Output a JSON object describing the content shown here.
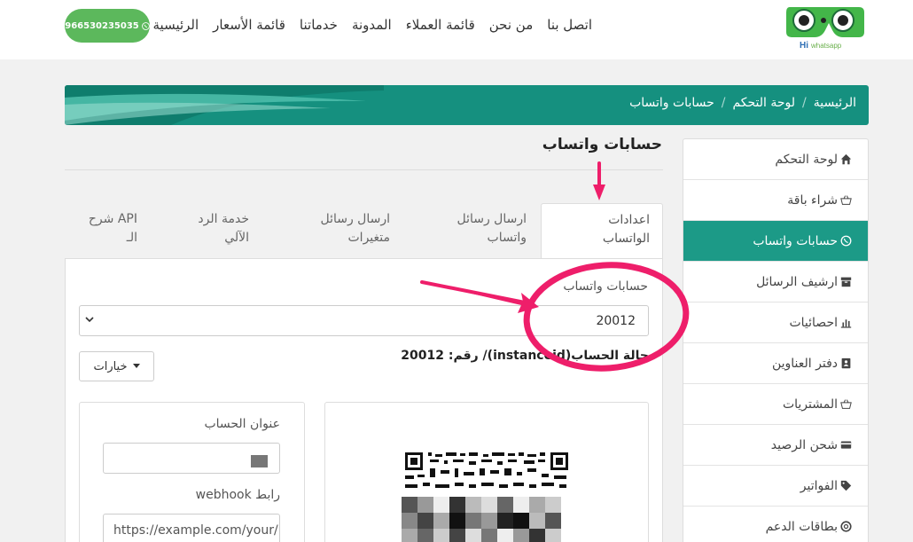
{
  "brand": {
    "logo_text": "Hi whatsapp"
  },
  "nav": {
    "items": [
      "الرئيسية",
      "قائمة الأسعار",
      "خدماتنا",
      "المدونة",
      "قائمة العملاء",
      "من نحن",
      "اتصل بنا"
    ],
    "phone": "966530235035"
  },
  "breadcrumb": [
    "الرئيسية",
    "لوحة التحكم",
    "حسابات واتساب"
  ],
  "sidebar": {
    "items": [
      {
        "label": "لوحة التحكم",
        "icon": "home-icon"
      },
      {
        "label": "شراء باقة",
        "icon": "basket-icon"
      },
      {
        "label": "حسابات واتساب",
        "icon": "whatsapp-icon",
        "active": true
      },
      {
        "label": "ارشيف الرسائل",
        "icon": "archive-icon"
      },
      {
        "label": "احصائيات",
        "icon": "bar-chart-icon"
      },
      {
        "label": "دفتر العناوين",
        "icon": "address-book-icon"
      },
      {
        "label": "المشتريات",
        "icon": "basket-icon"
      },
      {
        "label": "شحن الرصيد",
        "icon": "credit-card-icon"
      },
      {
        "label": "الفواتير",
        "icon": "tag-icon"
      },
      {
        "label": "بطاقات الدعم",
        "icon": "support-icon"
      }
    ]
  },
  "main": {
    "title": "حسابات واتساب",
    "tabs": [
      {
        "line1": "اعدادات",
        "line2": "الواتساب",
        "active": true
      },
      {
        "line1": "ارسال رسائل",
        "line2": "واتساب"
      },
      {
        "line1": "ارسال رسائل",
        "line2": "متغيرات"
      },
      {
        "line1": "خدمة الرد",
        "line2": "الآلي"
      },
      {
        "line1": "API شرح",
        "line2": "الـ"
      }
    ],
    "accounts_label": "حسابات واتساب",
    "selected_account": "20012",
    "status_text": "حالة الحساب(instanceid)/ رقم: 20012",
    "options_label": "خيارات",
    "account_address_label": "عنوان الحساب",
    "webhook_label": "رابط webhook",
    "webhook_placeholder": "https://example.com/your/"
  },
  "colors": {
    "brand_green": "#15907f",
    "active_green": "#1c9a87",
    "phone_green": "#5cb85c",
    "annotation_pink": "#ee1e6a"
  }
}
